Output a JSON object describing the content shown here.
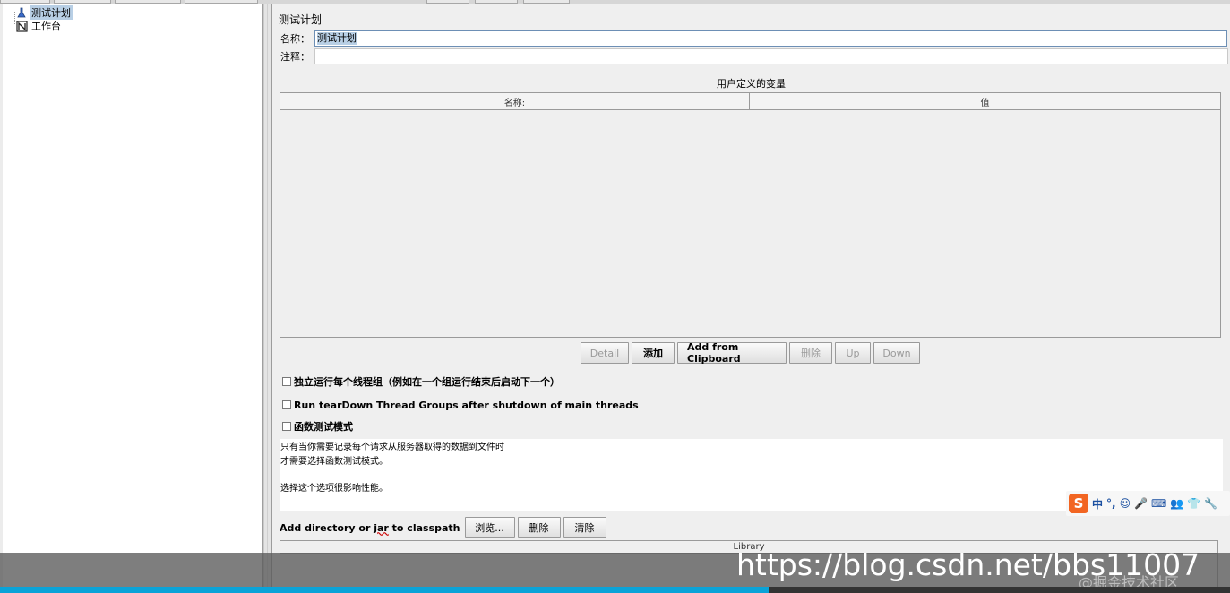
{
  "tree": {
    "items": [
      {
        "label": "测试计划",
        "icon": "test-plan-icon"
      },
      {
        "label": "工作台",
        "icon": "workbench-icon"
      }
    ]
  },
  "panel": {
    "title": "测试计划",
    "name_label": "名称：",
    "name_value": "测试计划",
    "comment_label": "注释：",
    "comment_value": "",
    "vars_title": "用户定义的变量",
    "vars_columns": [
      "名称:",
      "值"
    ],
    "buttons": {
      "detail": "Detail",
      "add": "添加",
      "add_clipboard": "Add from Clipboard",
      "delete": "删除",
      "up": "Up",
      "down": "Down"
    },
    "checkboxes": {
      "serialize": "独立运行每个线程组（例如在一个组运行结束后启动下一个）",
      "teardown": "Run tearDown Thread Groups after shutdown of main threads",
      "functional": "函数测试模式"
    },
    "description": {
      "line1": "只有当你需要记录每个请求从服务器取得的数据到文件时",
      "line2": "才需要选择函数测试模式。",
      "line3": "选择这个选项很影响性能。"
    },
    "classpath": {
      "label_pre": "Add directory or ",
      "label_jar": "jar",
      "label_post": " to classpath",
      "browse": "浏览...",
      "delete": "删除",
      "clear": "清除",
      "library_header": "Library"
    }
  },
  "ime": {
    "brand": "S",
    "glyphs": [
      "中",
      "°,",
      "☺",
      "🎤",
      "⌨",
      "👥",
      "👕",
      "🔧"
    ]
  },
  "watermark": {
    "url": "https://blog.csdn.net/bbs11007",
    "sub": "@掘金技术社区"
  },
  "video_progress": 0.625
}
